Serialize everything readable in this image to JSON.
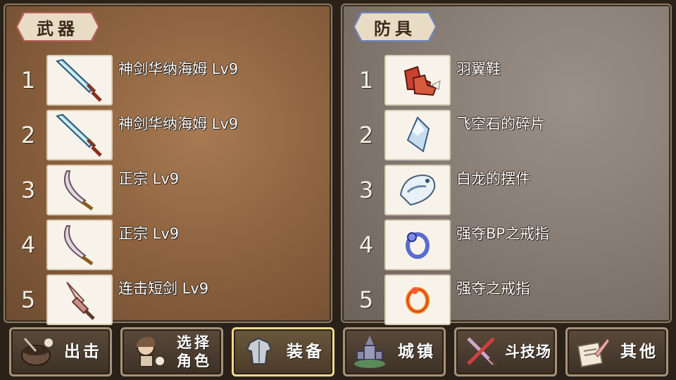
{
  "weapons": {
    "title": "武器",
    "items": [
      {
        "index": "1",
        "name": "神剑华纳海姆 Lv9",
        "icon": "sword-icon"
      },
      {
        "index": "2",
        "name": "神剑华纳海姆 Lv9",
        "icon": "sword-icon"
      },
      {
        "index": "3",
        "name": "正宗 Lv9",
        "icon": "katana-icon"
      },
      {
        "index": "4",
        "name": "正宗 Lv9",
        "icon": "katana-icon"
      },
      {
        "index": "5",
        "name": "连击短剑 Lv9",
        "icon": "dagger-icon"
      }
    ]
  },
  "armor": {
    "title": "防具",
    "items": [
      {
        "index": "1",
        "name": "羽翼鞋",
        "icon": "winged-boots-icon"
      },
      {
        "index": "2",
        "name": "飞空石的碎片",
        "icon": "crystal-shard-icon"
      },
      {
        "index": "3",
        "name": "白龙的摆件",
        "icon": "white-dragon-icon"
      },
      {
        "index": "4",
        "name": "强夺BP之戒指",
        "icon": "blue-ring-icon"
      },
      {
        "index": "5",
        "name": "强夺之戒指",
        "icon": "red-ring-icon"
      }
    ]
  },
  "nav": {
    "sortie": "出击",
    "select_line1": "选择",
    "select_line2": "角色",
    "equip": "装备",
    "town": "城镇",
    "arena": "斗技场",
    "other": "其他"
  },
  "colors": {
    "weapon_tag_border": "#b8615e",
    "armor_tag_border": "#6d86c0",
    "active_nav_border": "#f0d890"
  }
}
